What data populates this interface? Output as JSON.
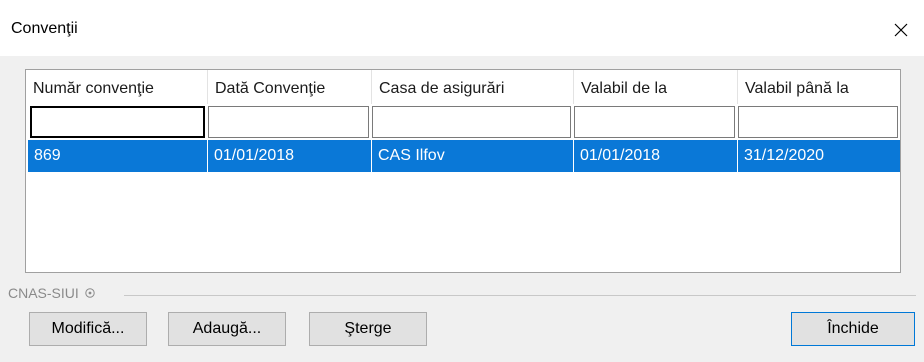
{
  "window": {
    "title": "Convenţii"
  },
  "grid": {
    "columns": [
      "Număr convenţie",
      "Dată Convenţie",
      "Casa de asigurări",
      "Valabil de la",
      "Valabil până la"
    ],
    "filters": [
      "",
      "",
      "",
      "",
      ""
    ],
    "rows": [
      [
        "869",
        "01/01/2018",
        "CAS Ilfov",
        "01/01/2018",
        "31/12/2020"
      ]
    ],
    "selected_row_color": "#0a78d7"
  },
  "footer": {
    "brand": "CNAS-SIUI"
  },
  "buttons": {
    "modify": "Modifică...",
    "add": "Adaugă...",
    "delete": "Şterge",
    "close": "Închide"
  },
  "icons": {
    "close": "close-icon",
    "registered": "registered-icon"
  }
}
